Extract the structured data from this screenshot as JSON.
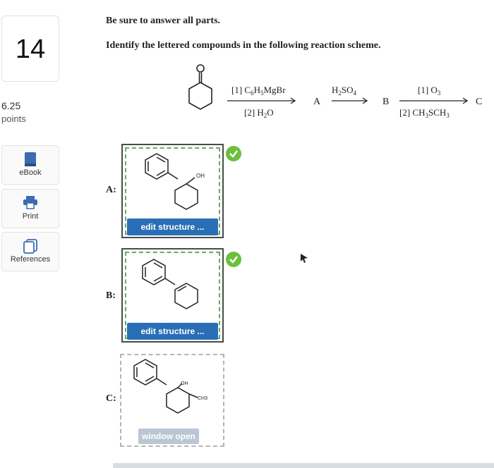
{
  "sidebar": {
    "question_number": "14",
    "points_value": "6.25",
    "points_label": "points",
    "tools": [
      {
        "label": "eBook",
        "icon": "book-icon"
      },
      {
        "label": "Print",
        "icon": "printer-icon"
      },
      {
        "label": "References",
        "icon": "references-icon"
      }
    ]
  },
  "question": {
    "instruction1": "Be sure to answer all parts.",
    "instruction2": "Identify the lettered compounds in the following reaction scheme."
  },
  "scheme": {
    "reagent1_top": "[1] C6H5MgBr",
    "reagent1_bottom": "[2] H2O",
    "reagent2_top": "H2SO4",
    "reagent3_top": "[1] O3",
    "reagent3_bottom": "[2] CH3SCH3",
    "label_a": "A",
    "label_b": "B",
    "label_c": "C"
  },
  "answers": {
    "a_label": "A:",
    "b_label": "B:",
    "c_label": "C:",
    "a_button": "edit structure ...",
    "b_button": "edit structure ...",
    "c_button": "window open",
    "a_oh": "OH",
    "c_oh": "OH",
    "c_ch3": "CH3"
  },
  "colors": {
    "accent_blue": "#2a6fb6",
    "check_green": "#6cbf3c",
    "box_border_green": "#6aa86a",
    "window_btn": "#b9c6d4"
  }
}
